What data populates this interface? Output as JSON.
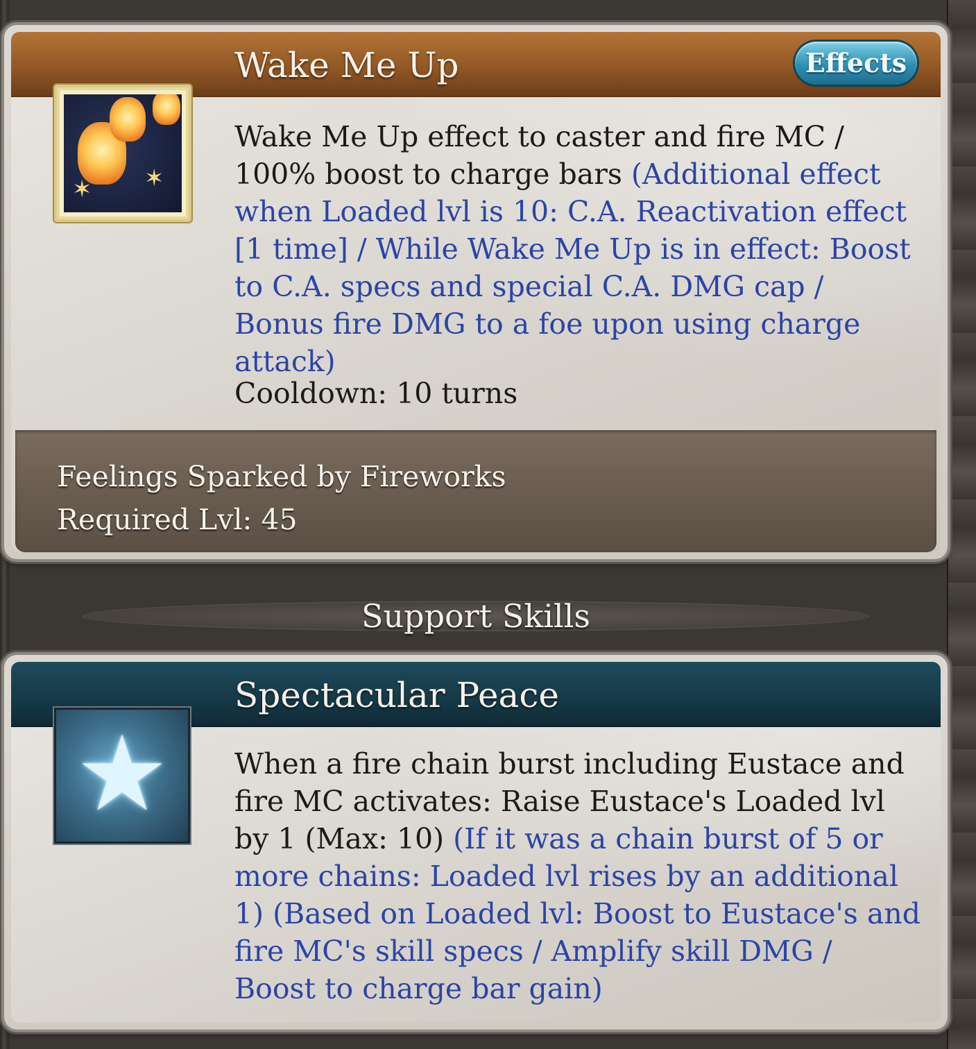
{
  "skill": {
    "title": "Wake Me Up",
    "effects_label": "Effects",
    "icon": "lantern-icon",
    "description_plain": "Wake Me Up effect to caster and fire MC / 100% boost to charge bars ",
    "description_extra": "(Additional effect when Loaded lvl is 10: C.A. Reactivation effect [1 time] / While Wake Me Up is in effect: Boost to C.A. specs and special C.A. DMG cap / Bonus fire DMG to a foe upon using charge attack)",
    "cooldown": "Cooldown: 10 turns",
    "unlock_name": "Feelings Sparked by Fireworks",
    "required_level": "Required Lvl: 45"
  },
  "section": {
    "title": "Support Skills"
  },
  "support_skill": {
    "title": "Spectacular Peace",
    "icon": "star-icon",
    "description_plain": "When a fire chain burst including Eustace and fire MC activates: Raise Eustace's Loaded lvl by 1 (Max: 10) ",
    "description_extra": "(If it was a chain burst of 5 or more chains: Loaded lvl rises by an additional 1) (Based on Loaded lvl: Boost to Eustace's and fire MC's skill specs / Amplify skill DMG / Boost to charge bar gain)"
  },
  "colors": {
    "header_orange": "#8f5524",
    "header_teal": "#163947",
    "extra_text_blue": "#2b44a6",
    "effects_button": "#2e8fb2"
  }
}
